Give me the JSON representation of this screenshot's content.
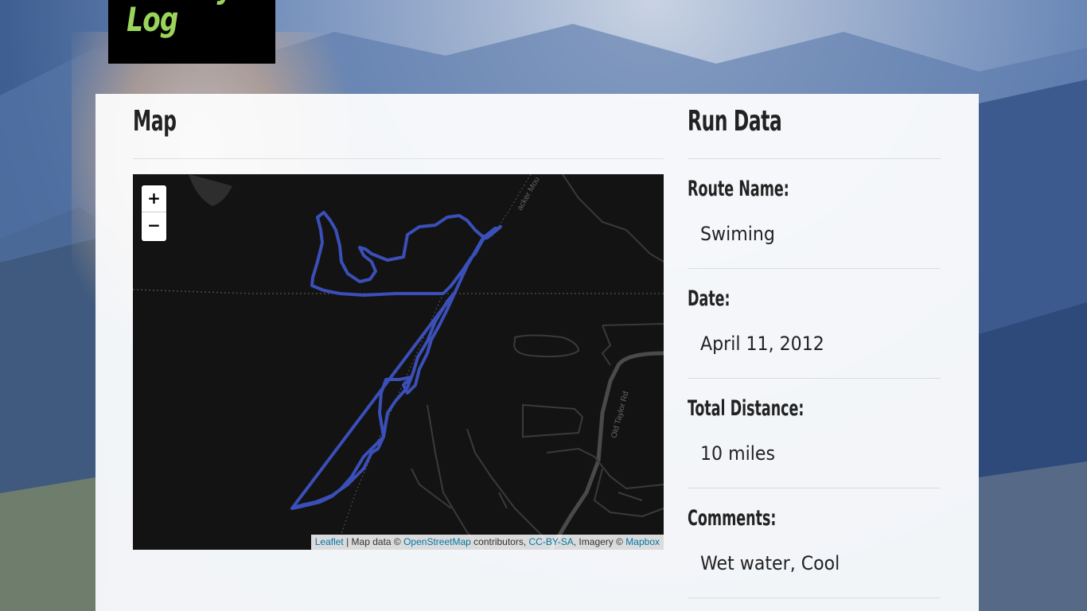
{
  "brand": {
    "title": "Activity Log",
    "color": "#9bd45b"
  },
  "map_section": {
    "title": "Map",
    "zoom_in_label": "+",
    "zoom_out_label": "−",
    "attribution": {
      "leaflet": "Leaflet",
      "text1": " | Map data © ",
      "osm": "OpenStreetMap",
      "text2": " contributors, ",
      "license": "CC-BY-SA",
      "text3": ", Imagery © ",
      "mapbox": "Mapbox"
    },
    "route_color": "#3b4fb8",
    "street_labels": [
      "acker Mou",
      "Old Taylor Rd"
    ]
  },
  "run_data": {
    "title": "Run Data",
    "fields": [
      {
        "label": "Route Name:",
        "value": "Swiming"
      },
      {
        "label": "Date:",
        "value": "April 11, 2012"
      },
      {
        "label": "Total Distance:",
        "value": "10 miles"
      },
      {
        "label": "Comments:",
        "value": "Wet water, Cool"
      }
    ]
  }
}
